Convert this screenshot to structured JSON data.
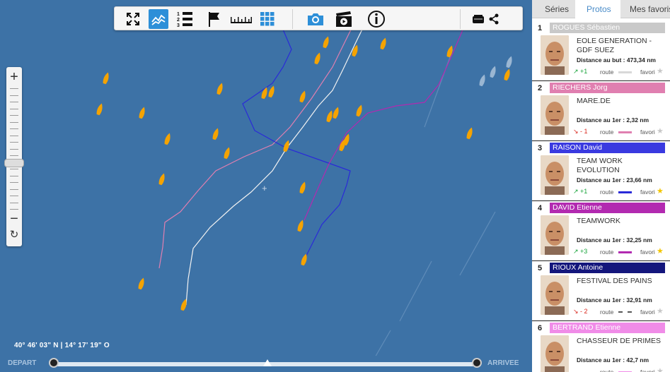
{
  "toolbar": {
    "buttons": [
      {
        "name": "fullscreen-icon"
      },
      {
        "name": "chart-icon"
      },
      {
        "name": "ranking-list-icon"
      },
      {
        "name": "flag-icon"
      },
      {
        "name": "ruler-icon"
      },
      {
        "name": "grid-icon"
      },
      {
        "name": "camera-icon"
      },
      {
        "name": "video-icon"
      },
      {
        "name": "info-icon"
      },
      {
        "name": "vr-headset-icon"
      },
      {
        "name": "share-icon"
      }
    ]
  },
  "map": {
    "coordinates": "40° 46' 03\" N  |  14° 17' 19\" O",
    "crosshair": "+"
  },
  "timeline": {
    "start_label": "DEPART",
    "end_label": "ARRIVEE"
  },
  "tabs": [
    {
      "label": "Séries"
    },
    {
      "label": "Protos"
    },
    {
      "label": "Mes favoris"
    }
  ],
  "active_tab": "Protos",
  "labels": {
    "route": "route",
    "favori": "favori"
  },
  "skippers": [
    {
      "rank": "1",
      "name": "ROGUES  Sébastien",
      "bar_color": "#c9c9c9",
      "boat": "EOLE GENERATION - GDF SUEZ",
      "distance": "Distance au but : 473,34 nm",
      "trend": "↗ +1",
      "trend_color": "#17a33a",
      "route_color": "#d8d8d8",
      "route_style": "solid",
      "fav": false
    },
    {
      "rank": "2",
      "name": "RIECHERS Jorg",
      "bar_color": "#e07fb0",
      "boat": "MARE.DE",
      "distance": "Distance au 1er : 2,32 nm",
      "trend": "↘ - 1",
      "trend_color": "#d9261c",
      "route_color": "#e07fb0",
      "route_style": "solid",
      "fav": false
    },
    {
      "rank": "3",
      "name": "RAISON  David",
      "bar_color": "#3a3ae0",
      "boat": "TEAM WORK EVOLUTION",
      "distance": "Distance au 1er : 23,66 nm",
      "trend": "↗ +1",
      "trend_color": "#17a33a",
      "route_color": "#2a2ad8",
      "route_style": "solid",
      "fav": true
    },
    {
      "rank": "4",
      "name": "DAVID Etienne",
      "bar_color": "#b22ab0",
      "boat": "TEAMWORK",
      "distance": "Distance au 1er : 32,25 nm",
      "trend": "↗ +3",
      "trend_color": "#17a33a",
      "route_color": "#b22ab0",
      "route_style": "solid",
      "fav": true
    },
    {
      "rank": "5",
      "name": "RIOUX  Antoine",
      "bar_color": "#14167c",
      "boat": "FESTIVAL DES PAINS",
      "distance": "Distance au 1er : 32,91 nm",
      "trend": "↘ - 2",
      "trend_color": "#d9261c",
      "route_color": "#555555",
      "route_style": "dashed",
      "fav": false
    },
    {
      "rank": "6",
      "name": "BERTRAND  Etienne",
      "bar_color": "#f08ce8",
      "boat": "CHASSEUR DE PRIMES",
      "distance": "Distance au 1er : 42,7 nm",
      "trend": "",
      "trend_color": "#17a33a",
      "route_color": "#f08ce8",
      "route_style": "solid",
      "fav": false
    }
  ],
  "colors": {
    "sea": "#3d72a6",
    "boat_marker": "#f5a300",
    "accent": "#4a8cc9"
  }
}
